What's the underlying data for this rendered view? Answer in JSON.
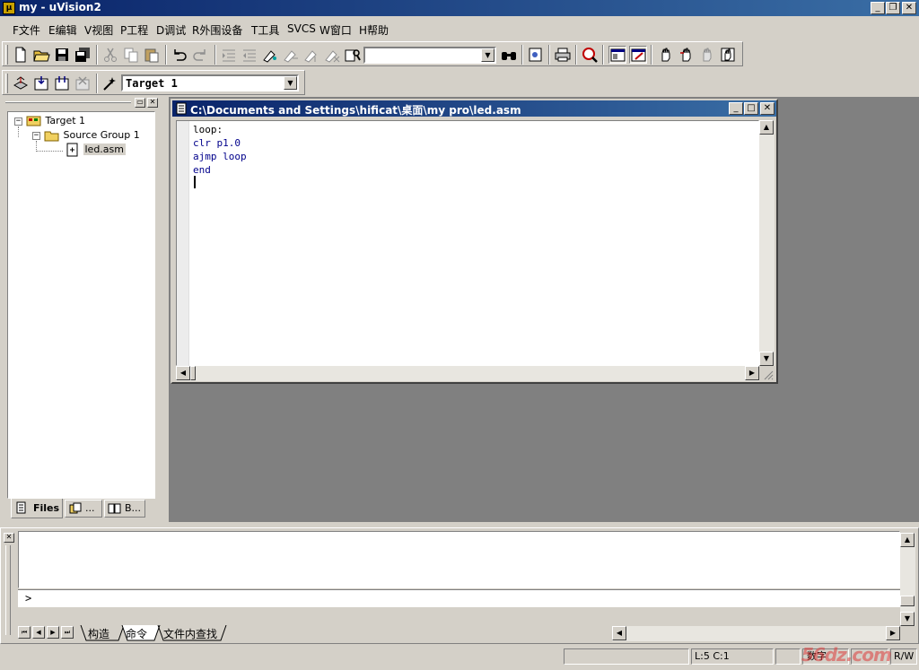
{
  "window": {
    "title": "my - uVision2"
  },
  "menu": [
    "F文件",
    "E编辑",
    "V视图",
    "P工程",
    "D调试",
    "R外围设备",
    "T工具",
    "SVCS",
    "W窗口",
    "H帮助"
  ],
  "toolbar": {
    "find_combo_value": "",
    "target_combo_value": "Target 1"
  },
  "project": {
    "tree": {
      "target": "Target 1",
      "group": "Source Group 1",
      "file": "led.asm"
    },
    "tabs": [
      "Files",
      "...",
      "B..."
    ]
  },
  "editor": {
    "title": "C:\\Documents and Settings\\hificat\\桌面\\my pro\\led.asm",
    "lines": [
      "loop:",
      "clr p1.0",
      "ajmp loop",
      "end"
    ]
  },
  "output": {
    "prompt": ">",
    "tabs": [
      "构造",
      "命令",
      "文件内查找"
    ]
  },
  "status": {
    "position": "L:5 C:1",
    "numlock": "数字",
    "mode": "R/W"
  },
  "watermark": "56dz.com"
}
